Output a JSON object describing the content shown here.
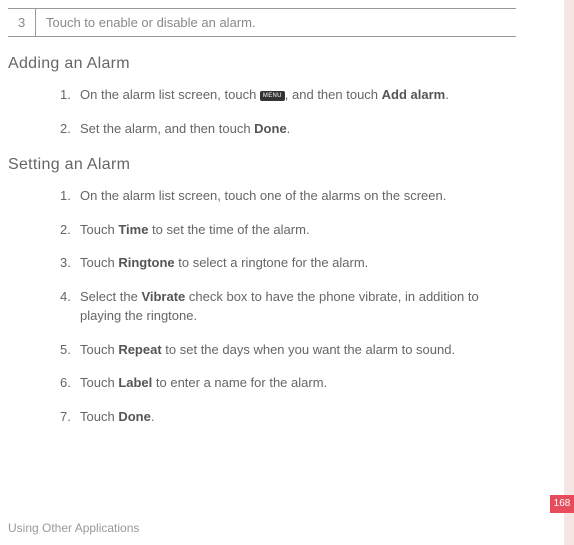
{
  "table": {
    "row": {
      "num": "3",
      "text": "Touch to enable or disable an alarm."
    }
  },
  "sections": {
    "adding": {
      "title": "Adding an Alarm",
      "steps": [
        {
          "num": "1.",
          "pre": "On the alarm list screen, touch ",
          "iconText": "MENU",
          "mid": ", and then touch ",
          "bold": "Add alarm",
          "post": "."
        },
        {
          "num": "2.",
          "pre": "Set the alarm, and then touch ",
          "bold": "Done",
          "post": "."
        }
      ]
    },
    "setting": {
      "title": "Setting an Alarm",
      "steps": [
        {
          "num": "1.",
          "pre": "On the alarm list screen, touch one of the alarms on the screen."
        },
        {
          "num": "2.",
          "pre": "Touch ",
          "bold": "Time",
          "post": " to set the time of the alarm."
        },
        {
          "num": "3.",
          "pre": "Touch ",
          "bold": "Ringtone",
          "post": " to select a ringtone for the alarm."
        },
        {
          "num": "4.",
          "pre": "Select the ",
          "bold": "Vibrate",
          "post": " check box to have the phone vibrate, in addition to playing the ringtone."
        },
        {
          "num": "5.",
          "pre": "Touch ",
          "bold": "Repeat",
          "post": " to set the days when you want the alarm to sound."
        },
        {
          "num": "6.",
          "pre": "Touch ",
          "bold": "Label",
          "post": " to enter a name for the alarm."
        },
        {
          "num": "7.",
          "pre": "Touch ",
          "bold": "Done",
          "post": "."
        }
      ]
    }
  },
  "footer": "Using Other Applications",
  "pageNumber": "168"
}
